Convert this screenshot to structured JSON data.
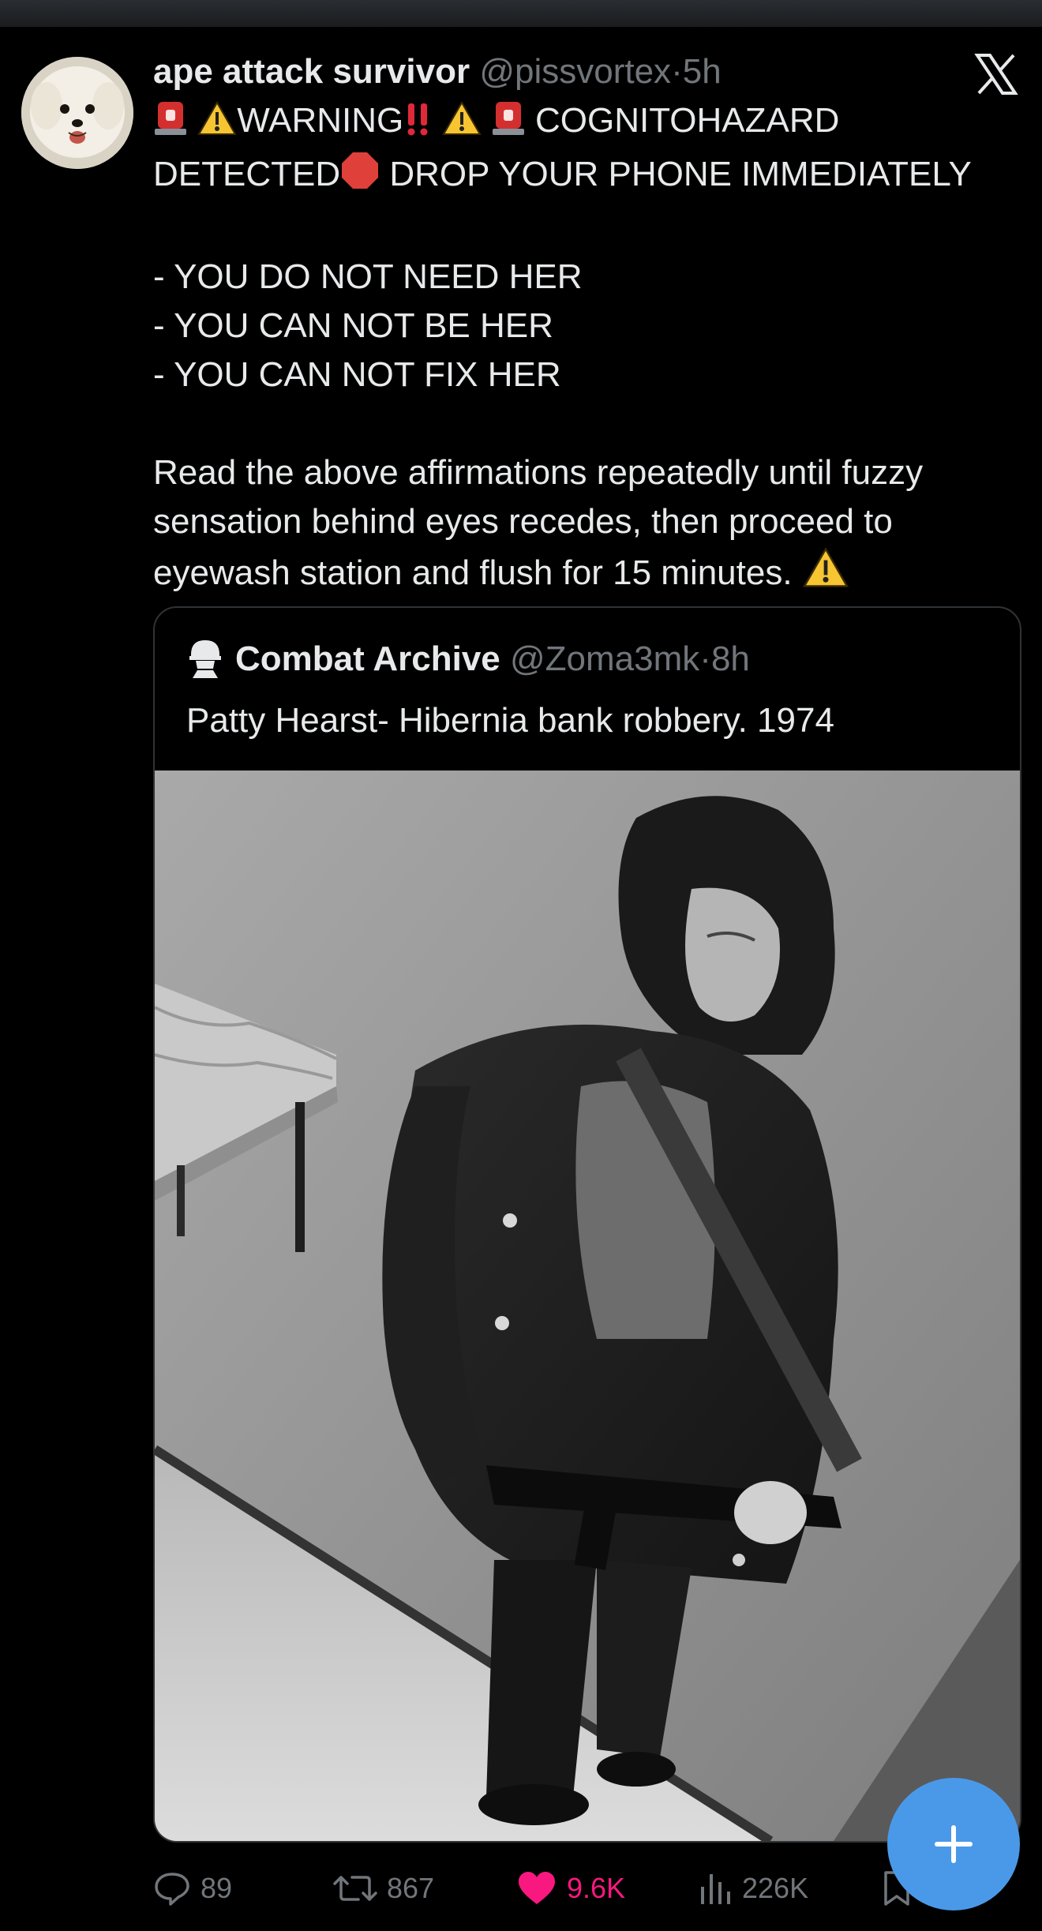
{
  "tweet": {
    "author_name": "ape attack survivor",
    "author_handle": "@pissvortex",
    "separator": "·",
    "time": "5h",
    "line1_text_a": "WARNING",
    "line1_text_b": "COGNITOHAZARD",
    "line2_text_a": "DETECTED",
    "line2_text_b": "DROP YOUR PHONE IMMEDIATELY",
    "affirmations": [
      "- YOU DO NOT NEED HER",
      "- YOU CAN NOT BE HER",
      "- YOU CAN NOT FIX HER"
    ],
    "paragraph_lines": [
      "Read the above affirmations repeatedly until fuzzy",
      "sensation behind eyes recedes, then proceed to",
      "eyewash station and flush for 15 minutes."
    ]
  },
  "quote": {
    "author_name": "Combat Archive",
    "author_handle": "@Zoma3mk",
    "separator": "·",
    "time": "8h",
    "text": "Patty Hearst- Hibernia bank robbery. 1974"
  },
  "actions": {
    "replies": "89",
    "reposts": "867",
    "likes": "9.6K",
    "views": "226K"
  },
  "icons": {
    "close": "x-logo-icon",
    "siren": "police-light-icon",
    "warning": "warning-sign-icon",
    "double_exclamation": "double-exclamation-icon",
    "stop": "stop-sign-icon",
    "reply": "speech-bubble-icon",
    "repost": "repost-arrows-icon",
    "like": "heart-icon",
    "views": "bar-chart-icon",
    "bookmark": "bookmark-icon",
    "compose": "plus-icon"
  },
  "colors": {
    "background": "#000000",
    "text": "#e7e9ea",
    "muted": "#71767b",
    "like_active": "#f91880",
    "fab": "#4a99e9"
  }
}
